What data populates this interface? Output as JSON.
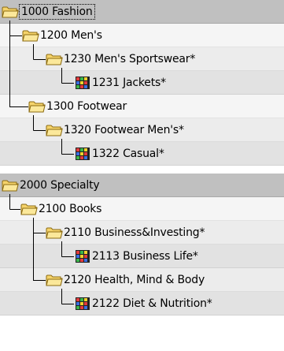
{
  "tree": {
    "nodes": [
      {
        "label": "1000 Fashion",
        "icon": "folder-icon"
      },
      {
        "label": "1200 Men's",
        "icon": "folder-icon"
      },
      {
        "label": "1230 Men's Sportswear*",
        "icon": "folder-icon"
      },
      {
        "label": "1231 Jackets*",
        "icon": "category-grid-icon"
      },
      {
        "label": "1300 Footwear",
        "icon": "folder-icon"
      },
      {
        "label": "1320 Footwear Men's*",
        "icon": "folder-icon"
      },
      {
        "label": "1322 Casual*",
        "icon": "category-grid-icon"
      },
      {
        "label": "2000 Specialty",
        "icon": "folder-icon"
      },
      {
        "label": "2100 Books",
        "icon": "folder-icon"
      },
      {
        "label": "2110 Business&Investing*",
        "icon": "folder-icon"
      },
      {
        "label": "2113 Business Life*",
        "icon": "category-grid-icon"
      },
      {
        "label": "2120 Health, Mind & Body",
        "icon": "folder-icon"
      },
      {
        "label": "2122 Diet & Nutrition*",
        "icon": "category-grid-icon"
      }
    ]
  }
}
